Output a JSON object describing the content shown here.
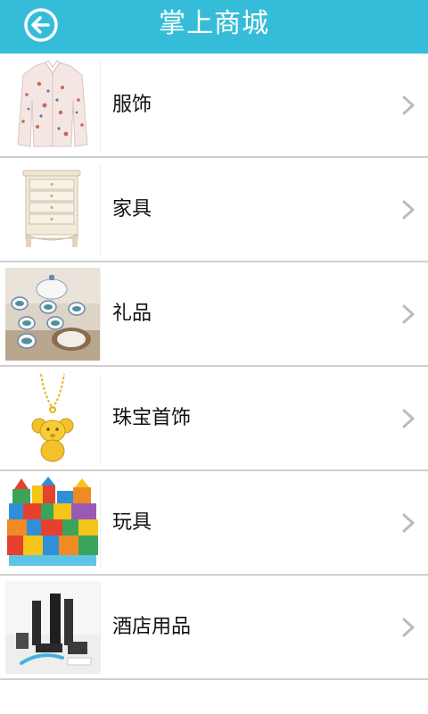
{
  "header": {
    "title": "掌上商城",
    "back_icon": "back-arrow-icon"
  },
  "categories": [
    {
      "label": "服饰",
      "icon": "chevron-right-icon"
    },
    {
      "label": "家具",
      "icon": "chevron-right-icon"
    },
    {
      "label": "礼品",
      "icon": "chevron-right-icon"
    },
    {
      "label": "珠宝首饰",
      "icon": "chevron-right-icon"
    },
    {
      "label": "玩具",
      "icon": "chevron-right-icon"
    },
    {
      "label": "酒店用品",
      "icon": "chevron-right-icon"
    }
  ],
  "colors": {
    "header_bg": "#35bcd9",
    "divider": "#cfcfcf",
    "chevron": "#bbbbbb"
  }
}
